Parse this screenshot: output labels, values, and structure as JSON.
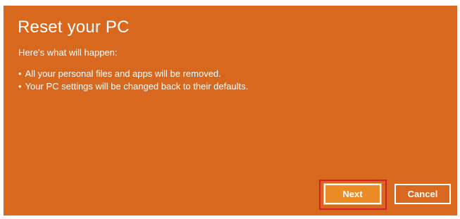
{
  "dialog": {
    "title": "Reset your PC",
    "intro": "Here's what will happen:",
    "bullets": [
      "All your personal files and apps will be removed.",
      "Your PC settings will be changed back to their defaults."
    ]
  },
  "buttons": {
    "next_label": "Next",
    "cancel_label": "Cancel"
  },
  "colors": {
    "dialog_background": "#d9681f",
    "next_button_background": "#ec8a26",
    "highlight_border": "#d4202a",
    "text": "#ffffff"
  }
}
